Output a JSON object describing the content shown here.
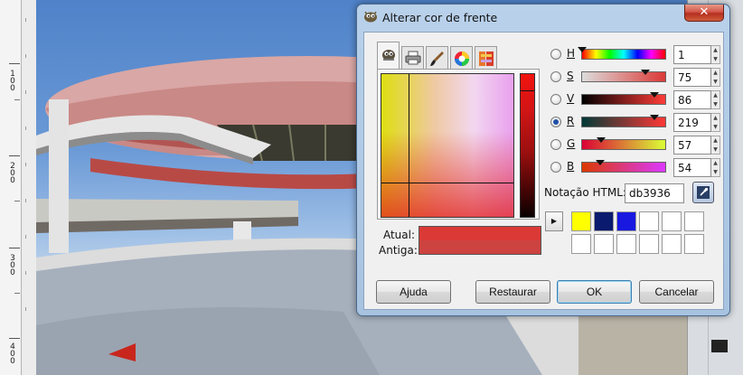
{
  "ruler": {
    "labels": [
      "100",
      "200",
      "300",
      "400"
    ]
  },
  "dialog": {
    "title": "Alterar cor de frente",
    "close_glyph": "✕",
    "app_icon": "gimp-icon",
    "tabs": [
      {
        "icon": "gimp-selector-icon",
        "active": true
      },
      {
        "icon": "cmyk-printer-icon",
        "active": false
      },
      {
        "icon": "watercolor-brush-icon",
        "active": false
      },
      {
        "icon": "color-wheel-icon",
        "active": false
      },
      {
        "icon": "palette-scales-icon",
        "active": false
      }
    ],
    "swatches": {
      "current_label": "Atual:",
      "old_label": "Antiga:",
      "current_color": "#db3936",
      "old_color": "#cc4340"
    },
    "sliders": [
      {
        "key": "H",
        "value": "1",
        "checked": false
      },
      {
        "key": "S",
        "value": "75",
        "checked": false
      },
      {
        "key": "V",
        "value": "86",
        "checked": false
      },
      {
        "key": "R",
        "value": "219",
        "checked": true
      },
      {
        "key": "G",
        "value": "57",
        "checked": false
      },
      {
        "key": "B",
        "value": "54",
        "checked": false
      }
    ],
    "html_notation": {
      "label": "Notação HTML:",
      "value": "db3936"
    },
    "history": {
      "arrow": "▶",
      "colors": [
        "#ffff00",
        "#0a1a6e",
        "#1818e0",
        "#ffffff",
        "#ffffff",
        "#ffffff",
        "#ffffff",
        "#ffffff",
        "#ffffff",
        "#ffffff",
        "#ffffff",
        "#ffffff"
      ]
    },
    "buttons": {
      "help": "Ajuda",
      "reset": "Restaurar",
      "ok": "OK",
      "cancel": "Cancelar"
    }
  }
}
